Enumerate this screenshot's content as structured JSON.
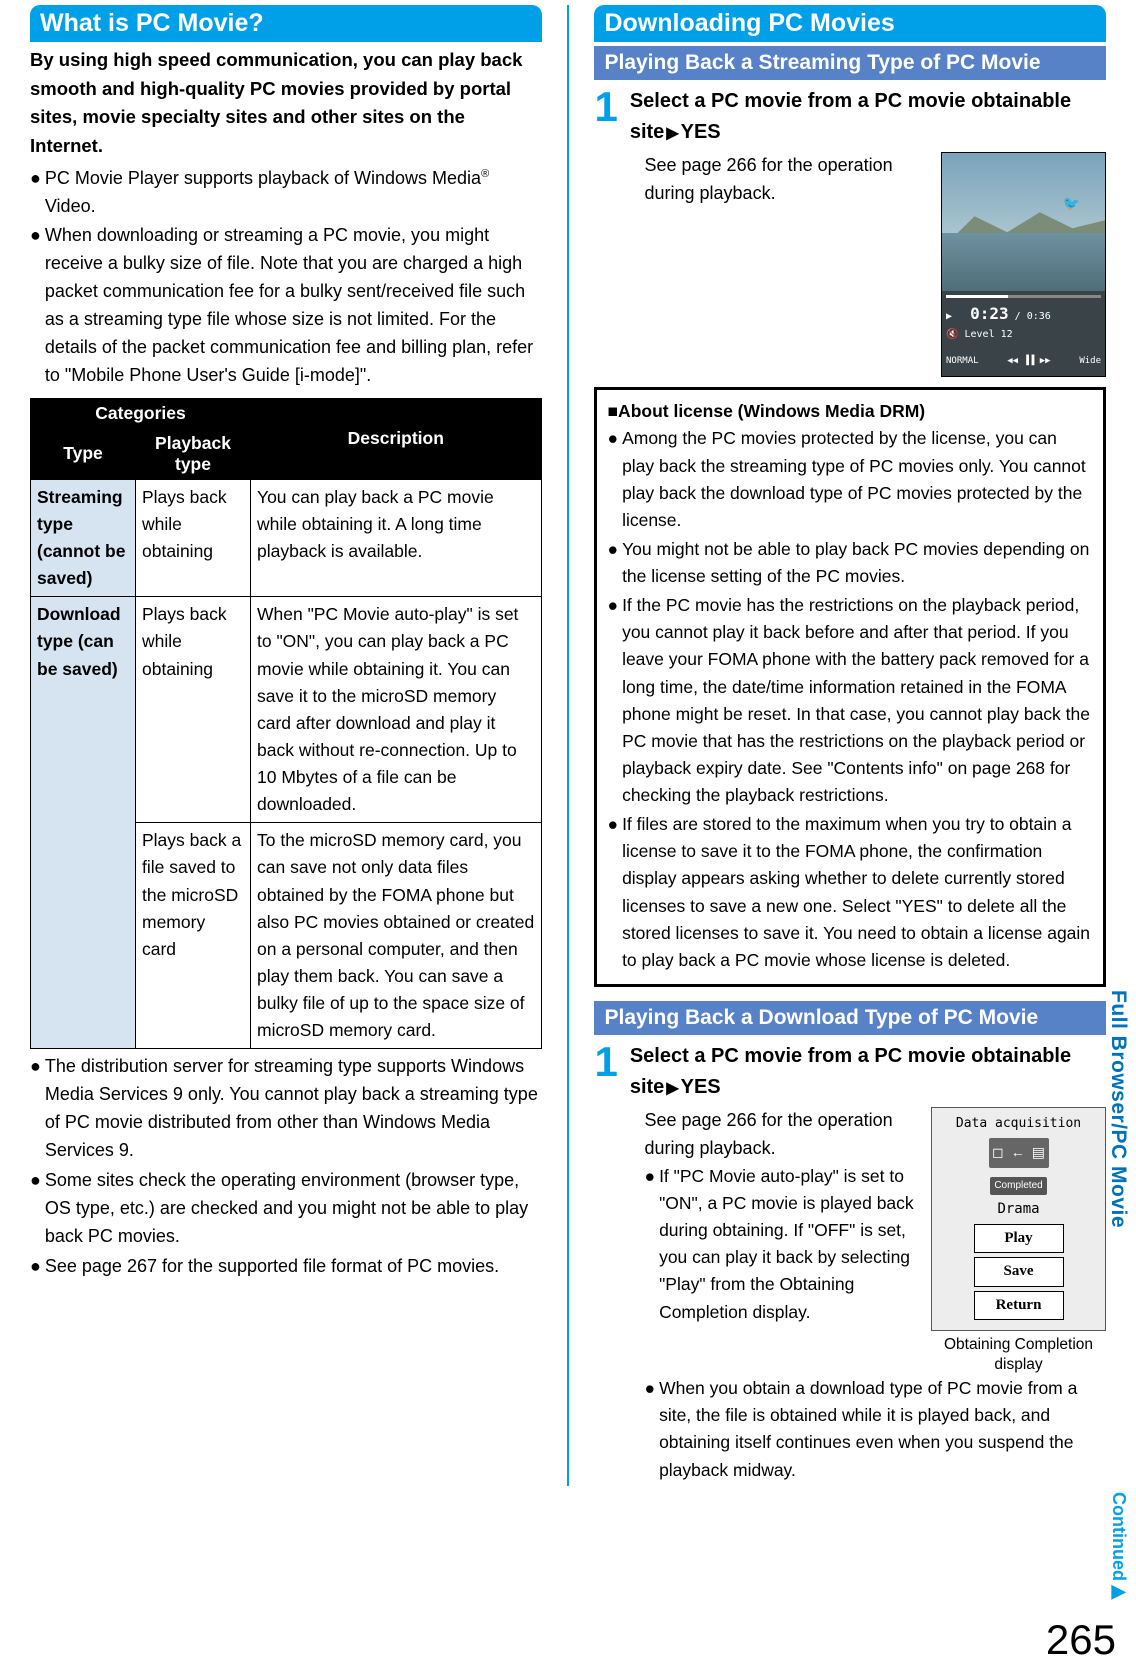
{
  "left": {
    "heading": "What is PC Movie?",
    "intro": "By using high speed communication, you can play back smooth and high-quality PC movies provided by portal sites, movie specialty sites and other sites on the Internet.",
    "bullets_top": [
      "PC Movie Player supports playback of Windows Media® Video.",
      "When downloading or streaming a PC movie, you might receive a bulky size of file. Note that you are charged a high packet communication fee for a bulky sent/received file such as a streaming type file whose size is not limited. For the details of the packet communication fee and billing plan, refer to \"Mobile Phone User's Guide [i-mode]\"."
    ],
    "table": {
      "head_categories": "Categories",
      "head_type": "Type",
      "head_playback": "Playback type",
      "head_desc": "Description",
      "rows": [
        {
          "type": "Streaming type (cannot be saved)",
          "playback": "Plays back while obtaining",
          "desc": "You can play back a PC movie while obtaining it. A long time playback is available."
        },
        {
          "type": "Download type (can be saved)",
          "playback": "Plays back while obtaining",
          "desc": "When \"PC Movie auto-play\" is set to \"ON\", you can play back a PC movie while obtaining it. You can save it to the microSD memory card after download and play it back without re-connection. Up to 10 Mbytes of a file can be downloaded."
        },
        {
          "type": "",
          "playback": "Plays back a file saved to the microSD memory card",
          "desc": "To the microSD memory card, you can save not only data files obtained by the FOMA phone but also PC movies obtained or created on a personal computer, and then play them back. You can save a bulky file of up to the space size of microSD memory card."
        }
      ]
    },
    "bullets_bottom": [
      "The distribution server for streaming type supports Windows Media Services 9 only. You cannot play back a streaming type of PC movie distributed from other than Windows Media Services 9.",
      "Some sites check the operating environment (browser type, OS type, etc.) are checked and you might not be able to play back PC movies.",
      "See page 267 for the supported file format of PC movies."
    ]
  },
  "right": {
    "heading": "Downloading PC Movies",
    "section1": {
      "subheading": "Playing Back a Streaming Type of PC Movie",
      "step_num": "1",
      "step_title_a": "Select a PC movie from a PC movie obtainable site",
      "step_title_b": "YES",
      "step_body": "See page 266 for the operation during playback.",
      "video": {
        "time": "0:23",
        "dur": "/ 0:36",
        "level": "Level 12",
        "normal": "NORMAL",
        "wide": "Wide"
      }
    },
    "license": {
      "title": "■About license (Windows Media DRM)",
      "bullets": [
        "Among the PC movies protected by the license, you can play back the streaming type of PC movies only. You cannot play back the download type of PC movies protected by the license.",
        "You might not be able to play back PC movies depending on the license setting of the PC movies.",
        "If the PC movie has the restrictions on the playback period, you cannot play it back before and after that period. If you leave your FOMA phone with the battery pack removed for a long time, the date/time information retained in the FOMA phone might be reset. In that case, you cannot play back the PC movie that has the restrictions on the playback period or playback expiry date. See \"Contents info\" on page 268 for checking the playback restrictions.",
        "If files are stored to the maximum when you try to obtain a license to save it to the FOMA phone, the confirmation display appears asking whether to delete currently stored licenses to save a new one. Select \"YES\" to delete all the stored licenses to save it. You need to obtain a license again to play back a PC movie whose license is deleted."
      ]
    },
    "section2": {
      "subheading": "Playing Back a Download Type of PC Movie",
      "step_num": "1",
      "step_title_a": "Select a PC movie from a PC movie obtainable site",
      "step_title_b": "YES",
      "step_body": "See page 266 for the operation during playback.",
      "sub_bullets": [
        "If \"PC Movie auto-play\" is set to \"ON\", a PC movie is played back during obtaining. If \"OFF\" is set, you can play it back by selecting \"Play\" from the Obtaining Completion display.",
        "When you obtain a download type of PC movie from a site, the file is obtained while it is played back, and obtaining itself continues even when you suspend the playback midway."
      ],
      "dm": {
        "top": "Data acquisition",
        "completed": "Completed",
        "drama": "Drama",
        "play": "Play",
        "save": "Save",
        "return": "Return",
        "caption": "Obtaining Completion display"
      }
    }
  },
  "side_tab": "Full Browser/PC Movie",
  "continued": "Continued▶",
  "page_num": "265"
}
